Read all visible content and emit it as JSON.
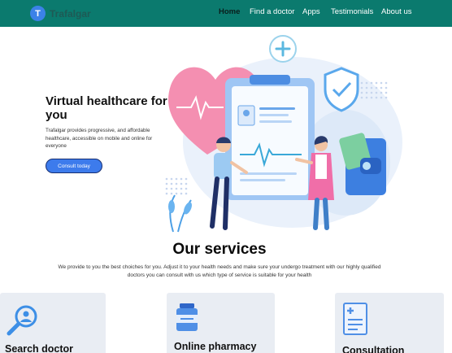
{
  "brand": {
    "logo_letter": "T",
    "name": "Trafalgar"
  },
  "nav": {
    "items": [
      {
        "label": "Home",
        "active": true
      },
      {
        "label": "Find a doctor",
        "active": false
      },
      {
        "label": "Apps",
        "active": false
      },
      {
        "label": "Testimonials",
        "active": false
      },
      {
        "label": "About us",
        "active": false
      }
    ]
  },
  "hero": {
    "title": "Virtual healthcare for you",
    "description": "Trafalgar provides progressive, and affordable healthcare, accessible on mobile and online for everyone",
    "cta_label": "Consult today"
  },
  "services": {
    "title": "Our services",
    "description": "We provide to you the best choiches for you. Adjust it to your health needs and make sure your undergo treatment with our highly qualified doctors you can consult with us which type of service is suitable for your health",
    "cards": [
      {
        "label": "Search doctor",
        "icon": "search-doctor-icon"
      },
      {
        "label": "Online pharmacy",
        "icon": "pharmacy-icon"
      },
      {
        "label": "Consultation",
        "icon": "consultation-icon"
      }
    ]
  },
  "colors": {
    "navbar": "#0b7a6e",
    "accent": "#3d7bec",
    "card_bg": "#e9edf3",
    "heart": "#f48fb1"
  }
}
